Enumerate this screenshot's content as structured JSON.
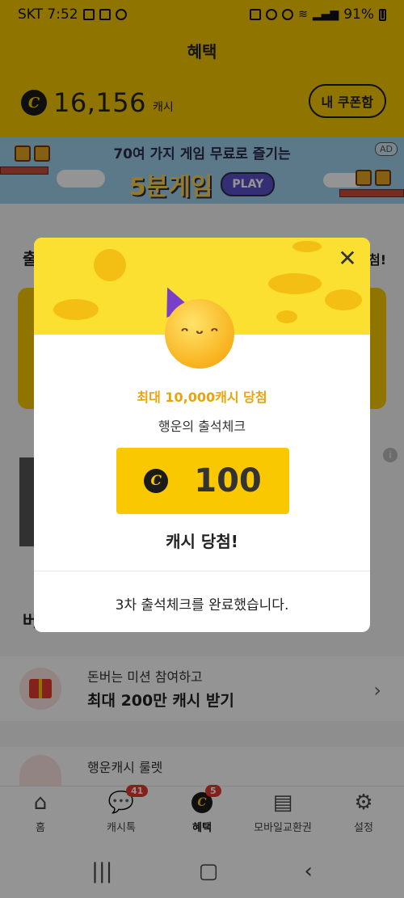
{
  "status_bar": {
    "carrier_time": "SKT 7:52",
    "battery": "91%"
  },
  "header": {
    "title": "혜택",
    "cash_amount": "16,156",
    "cash_unit": "캐시",
    "coupon_button": "내 쿠폰함"
  },
  "ad_banner": {
    "line1": "70여 가지 게임 무료로 즐기는",
    "game_title": "5분게임",
    "play_label": "PLAY",
    "ad_tag": "AD"
  },
  "background": {
    "section_head_partial": "출",
    "section_head_right_partial": "첨!",
    "section2_head_partial": "버",
    "rows": [
      {
        "sub": "돈버는 미션 참여하고",
        "main": "최대 200만 캐시 받기"
      },
      {
        "sub": "행운캐시 룰렛",
        "main": ""
      }
    ]
  },
  "modal": {
    "title": "최대 10,000캐시 당첨",
    "subtitle": "행운의 출석체크",
    "amount": "100",
    "result": "캐시 당첨!",
    "footer": "3차 출석체크를 완료했습니다.",
    "coin_symbol": "C"
  },
  "bottom_nav": [
    {
      "label": "홈",
      "icon": "home-icon",
      "badge": ""
    },
    {
      "label": "캐시톡",
      "icon": "talk-icon",
      "badge": "41"
    },
    {
      "label": "혜택",
      "icon": "benefit-icon",
      "badge": "5",
      "active": true
    },
    {
      "label": "모바일교환권",
      "icon": "voucher-icon",
      "badge": ""
    },
    {
      "label": "설정",
      "icon": "gear-icon",
      "badge": ""
    }
  ],
  "colors": {
    "brand_yellow": "#f9c800",
    "accent_orange": "#e8a40b",
    "badge_red": "#e23a2e"
  }
}
